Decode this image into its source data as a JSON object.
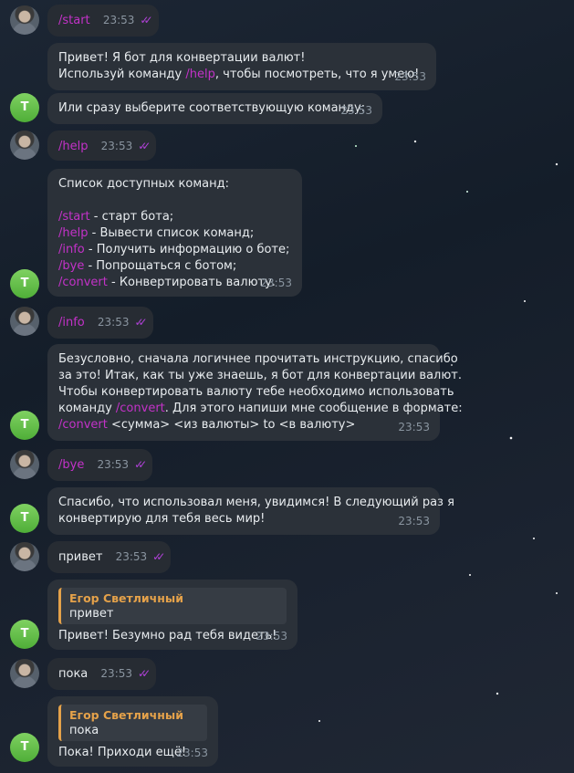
{
  "chat": {
    "messages": [
      {
        "sender": "user",
        "text": "/start",
        "time": "23:53"
      },
      {
        "sender": "bot",
        "lines": [
          "Привет! Я бот для конвертации валют!"
        ],
        "line2_before": "Используй команду ",
        "line2_cmd": "/help",
        "line2_after": ", чтобы посмотреть, что я умею!",
        "time": "23:53"
      },
      {
        "sender": "bot",
        "text": "Или сразу выберите соответствующую команду:",
        "time": "23:53",
        "avatar_letter": "T"
      },
      {
        "sender": "user",
        "text": "/help",
        "time": "23:53"
      },
      {
        "sender": "bot",
        "title": "Список доступных команд:",
        "commands": [
          {
            "cmd": "/start",
            "desc": " - старт бота;"
          },
          {
            "cmd": "/help",
            "desc": " - Вывести список команд;"
          },
          {
            "cmd": "/info",
            "desc": " - Получить информацию о боте;"
          },
          {
            "cmd": "/bye",
            "desc": " - Попрощаться с ботом;"
          },
          {
            "cmd": "/convert",
            "desc": " - Конвертировать валюту."
          }
        ],
        "time": "23:53",
        "avatar_letter": "T"
      },
      {
        "sender": "user",
        "text": "/info",
        "time": "23:53"
      },
      {
        "sender": "bot",
        "line1": "Безусловно, сначала логичнее прочитать инструкцию, спасибо",
        "line2": "за это! Итак, как ты уже знаешь, я бот для конвертации валют.",
        "line3": "Чтобы конвертировать валюту тебе необходимо использовать",
        "line4_before": "команду ",
        "line4_cmd": "/convert",
        "line4_after": ". Для этого напиши мне сообщение в формате:",
        "line5_cmd": "/convert",
        "line5_after": " <сумма> <из валюты> to <в валюту>",
        "time": "23:53",
        "avatar_letter": "T"
      },
      {
        "sender": "user",
        "text": "/bye",
        "time": "23:53"
      },
      {
        "sender": "bot",
        "line1": "Спасибо, что использовал меня, увидимся! В следующий раз я",
        "line2": "конвертирую для тебя весь мир!",
        "time": "23:53",
        "avatar_letter": "T"
      },
      {
        "sender": "user",
        "text": "привет",
        "time": "23:53"
      },
      {
        "sender": "bot",
        "reply_name": "Егор Светличный",
        "reply_text": "привет",
        "text": "Привет! Безумно рад тебя видеть!",
        "time": "23:53",
        "avatar_letter": "T"
      },
      {
        "sender": "user",
        "text": "пока",
        "time": "23:53"
      },
      {
        "sender": "bot",
        "reply_name": "Егор Светличный",
        "reply_text": "пока",
        "text": "Пока! Приходи ещё!",
        "time": "23:53",
        "avatar_letter": "T"
      }
    ]
  },
  "colors": {
    "command": "#c332c8",
    "bubble": "#2b3139",
    "reply_accent": "#e5a24a",
    "read_checks": "#b041d8"
  },
  "icons": {
    "read": "double-check-icon"
  }
}
